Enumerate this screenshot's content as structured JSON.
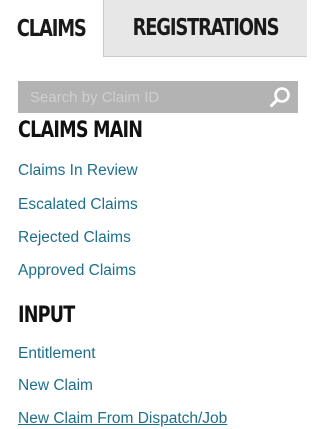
{
  "tabs": {
    "claims": "CLAIMS",
    "registrations": "REGISTRATIONS"
  },
  "search": {
    "placeholder": "Search by Claim ID"
  },
  "claims_main": {
    "title": "CLAIMS MAIN",
    "items": [
      {
        "label": "Claims In Review"
      },
      {
        "label": "Escalated Claims"
      },
      {
        "label": "Rejected Claims"
      },
      {
        "label": "Approved Claims"
      }
    ]
  },
  "input": {
    "title": "INPUT",
    "items": [
      {
        "label": "Entitlement"
      },
      {
        "label": "New Claim"
      },
      {
        "label": "New Claim From Dispatch/Job"
      }
    ]
  },
  "colors": {
    "link": "#1e6f8c",
    "search_bg": "#b3b3b3",
    "inactive_tab_bg": "#e7e7e7"
  }
}
